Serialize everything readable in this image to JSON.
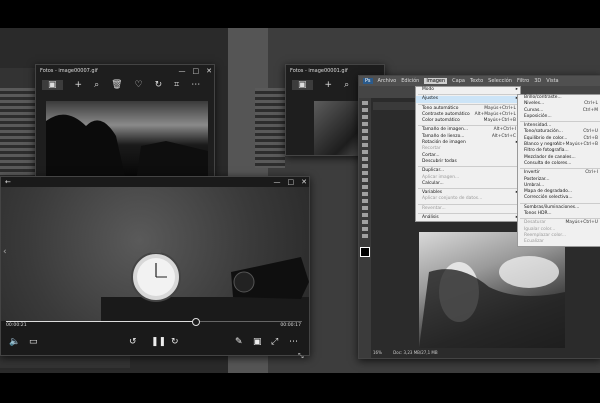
{
  "window_left": {
    "title": "Fotos - image00007.gif",
    "controls": [
      "—",
      "□",
      "✕"
    ]
  },
  "window_mid": {
    "title": "Fotos - image00001.gif",
    "controls": [
      "—",
      "□",
      "✕"
    ]
  },
  "window_front": {
    "title": "Fotos - image00006.gif",
    "controls": [
      "—",
      "□",
      "✕"
    ],
    "time_current": "00:00:21",
    "time_total": "00:00:17",
    "progress": 0.64
  },
  "photoshop": {
    "menu": [
      "Archivo",
      "Edición",
      "Imagen",
      "Capa",
      "Texto",
      "Selección",
      "Filtro",
      "3D",
      "Vista"
    ],
    "active_menu": "Imagen",
    "doc_tab": "",
    "status": "16%",
    "status_doc": "Doc: 3,23 MB/27,1 MB",
    "image_menu": [
      {
        "label": "Modo",
        "arrow": true
      },
      {
        "sep": true
      },
      {
        "label": "Ajustes",
        "arrow": true,
        "hi": true
      },
      {
        "sep": true
      },
      {
        "label": "Tono automático",
        "sc": "Mayús+Ctrl+L"
      },
      {
        "label": "Contraste automático",
        "sc": "Alt+Mayús+Ctrl+L"
      },
      {
        "label": "Color automático",
        "sc": "Mayús+Ctrl+B"
      },
      {
        "sep": true
      },
      {
        "label": "Tamaño de imagen...",
        "sc": "Alt+Ctrl+I"
      },
      {
        "label": "Tamaño de lienzo...",
        "sc": "Alt+Ctrl+C"
      },
      {
        "label": "Rotación de imagen",
        "arrow": true
      },
      {
        "label": "Recortar",
        "dis": true
      },
      {
        "label": "Cortar..."
      },
      {
        "label": "Descubrir todas"
      },
      {
        "sep": true
      },
      {
        "label": "Duplicar..."
      },
      {
        "label": "Aplicar imagen...",
        "dis": true
      },
      {
        "label": "Calcular..."
      },
      {
        "sep": true
      },
      {
        "label": "Variables",
        "arrow": true
      },
      {
        "label": "Aplicar conjunto de datos...",
        "dis": true
      },
      {
        "sep": true
      },
      {
        "label": "Reventar...",
        "dis": true
      },
      {
        "sep": true
      },
      {
        "label": "Análisis",
        "arrow": true
      }
    ],
    "adjust_menu": [
      {
        "label": "Brillo/contraste..."
      },
      {
        "label": "Niveles...",
        "sc": "Ctrl+L"
      },
      {
        "label": "Curvas...",
        "sc": "Ctrl+M"
      },
      {
        "label": "Exposición..."
      },
      {
        "sep": true
      },
      {
        "label": "Intensidad..."
      },
      {
        "label": "Tono/saturación...",
        "sc": "Ctrl+U"
      },
      {
        "label": "Equilibrio de color...",
        "sc": "Ctrl+B"
      },
      {
        "label": "Blanco y negro...",
        "sc": "Alt+Mayús+Ctrl+B"
      },
      {
        "label": "Filtro de fotografía..."
      },
      {
        "label": "Mezclador de canales..."
      },
      {
        "label": "Consulta de colores..."
      },
      {
        "sep": true
      },
      {
        "label": "Invertir",
        "sc": "Ctrl+I"
      },
      {
        "label": "Posterizar..."
      },
      {
        "label": "Umbral..."
      },
      {
        "label": "Mapa de degradado..."
      },
      {
        "label": "Corrección selectiva..."
      },
      {
        "sep": true
      },
      {
        "label": "Sombras/iluminaciones..."
      },
      {
        "label": "Tonos HDR..."
      },
      {
        "sep": true
      },
      {
        "label": "Desaturar",
        "sc": "Mayús+Ctrl+U",
        "dis": true
      },
      {
        "label": "Igualar color...",
        "dis": true
      },
      {
        "label": "Reemplazar color...",
        "dis": true
      },
      {
        "label": "Ecualizar",
        "dis": true
      }
    ]
  }
}
